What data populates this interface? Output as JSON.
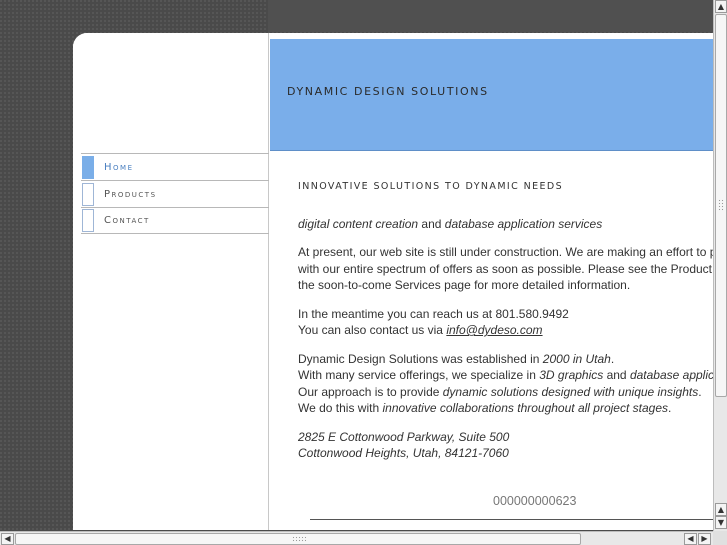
{
  "site": {
    "title": "DYNAMIC DESIGN SOLUTIONS"
  },
  "nav": {
    "items": [
      {
        "label": "Home",
        "active": true
      },
      {
        "label": "Products",
        "active": false
      },
      {
        "label": "Contact",
        "active": false
      }
    ]
  },
  "content": {
    "heading": "INNOVATIVE SOLUTIONS TO DYNAMIC NEEDS",
    "tagline": {
      "part1": "digital content creation",
      "part2": " and ",
      "part3": "database application services"
    },
    "intro": {
      "line1": "At present, our web site is still under construction. We are making an effort to p",
      "line2": "with our entire spectrum of offers as soon as possible. Please see the Product",
      "line3": "the soon-to-come Services page for more detailed information."
    },
    "contact": {
      "line1": "In the meantime you can reach us at 801.580.9492",
      "line2_prefix": "You can also contact us via ",
      "email": "info@dydeso.com"
    },
    "about": {
      "l1_a": "Dynamic Design Solutions was established in ",
      "l1_b": "2000 in Utah",
      "l1_c": ".",
      "l2_a": "With many service offerings, we specialize in ",
      "l2_b": "3D graphics",
      "l2_c": " and ",
      "l2_d": "database applic",
      "l3_a": "Our approach is to provide ",
      "l3_b": "dynamic solutions designed with unique insights",
      "l3_c": ".",
      "l4_a": "We do this with ",
      "l4_b": "innovative collaborations throughout all project stages",
      "l4_c": "."
    },
    "address": {
      "line1": "2825 E Cottonwood Parkway, Suite 500",
      "line2": "Cottonwood Heights, Utah, 84121-7060"
    },
    "counter": "000000000623"
  },
  "scrollbars": {
    "up_icon": "▲",
    "down_icon": "▼",
    "left_icon": "◀",
    "right_icon": "▶"
  },
  "colors": {
    "banner": "#7aaeea",
    "accent": "#4a7fc0"
  }
}
